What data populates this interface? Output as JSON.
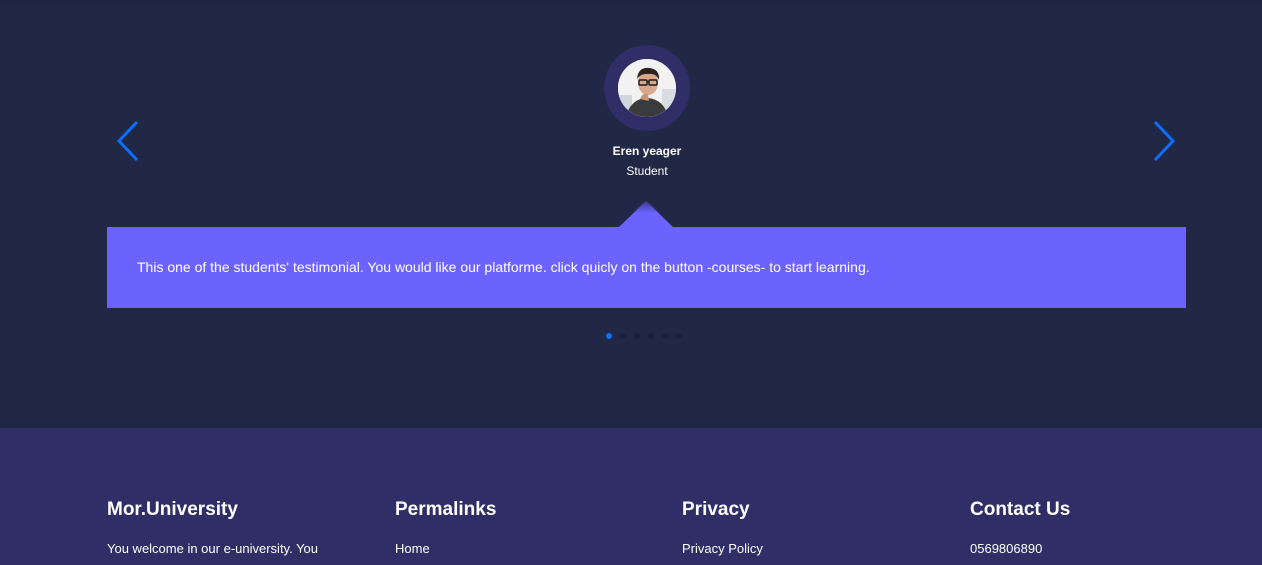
{
  "testimonial": {
    "name": "Eren yeager",
    "role": "Student",
    "quote": "This one of the students' testimonial. You would like our platforme. click quicly on the button -courses- to start learning.",
    "dots_total": 6,
    "dots_active_index": 0,
    "accent_color": "#6c63ff",
    "arrow_color": "#0d6efd"
  },
  "footer": {
    "col1": {
      "title": "Mor.University",
      "text": "You welcome in our e-university. You"
    },
    "col2": {
      "title": "Permalinks",
      "link": "Home"
    },
    "col3": {
      "title": "Privacy",
      "link": "Privacy Policy"
    },
    "col4": {
      "title": "Contact Us",
      "phone": "0569806890"
    },
    "background_color": "#2f2e67"
  }
}
